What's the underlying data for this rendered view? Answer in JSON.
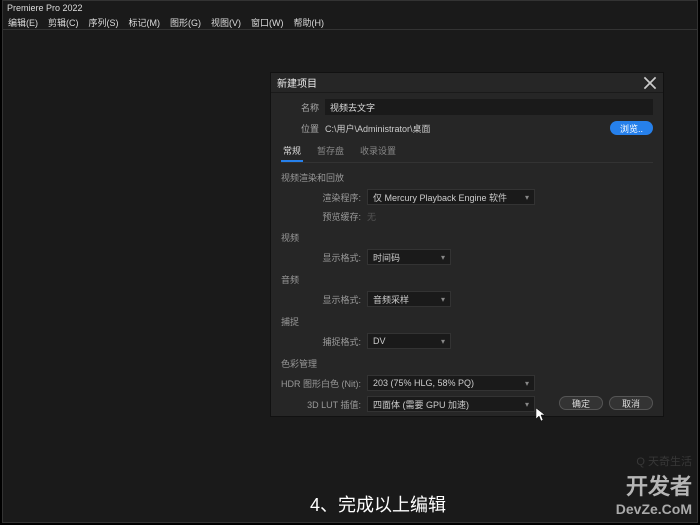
{
  "app_title": "Premiere Pro 2022",
  "menu": [
    "编辑(E)",
    "剪辑(C)",
    "序列(S)",
    "标记(M)",
    "图形(G)",
    "视图(V)",
    "窗口(W)",
    "帮助(H)"
  ],
  "dialog": {
    "title": "新建项目",
    "name_label": "名称",
    "name_value": "视频去文字",
    "location_label": "位置",
    "location_value": "C:\\用户\\Administrator\\桌面",
    "browse": "浏览..",
    "tabs": [
      "常规",
      "暂存盘",
      "收录设置"
    ],
    "section_render": "视频渲染和回放",
    "renderer_label": "渲染程序:",
    "renderer_value": "仅 Mercury Playback Engine 软件",
    "preview_cache_label": "预览缓存:",
    "preview_cache_value": "无",
    "section_video": "视频",
    "video_display_label": "显示格式:",
    "video_display_value": "时间码",
    "section_audio": "音频",
    "audio_display_label": "显示格式:",
    "audio_display_value": "音频采样",
    "section_capture": "捕捉",
    "capture_label": "捕捉格式:",
    "capture_value": "DV",
    "section_color": "色彩管理",
    "hdr_label": "HDR 图形白色 (Nit):",
    "hdr_value": "203 (75% HLG, 58% PQ)",
    "lut_label": "3D LUT 插值:",
    "lut_value": "四面体 (需要 GPU 加速)",
    "ok": "确定",
    "cancel": "取消"
  },
  "watermark": {
    "line1": "Q 天奇生活",
    "line2": "开发者",
    "line3": "DevZe.CoM"
  },
  "caption": "4、完成以上编辑"
}
